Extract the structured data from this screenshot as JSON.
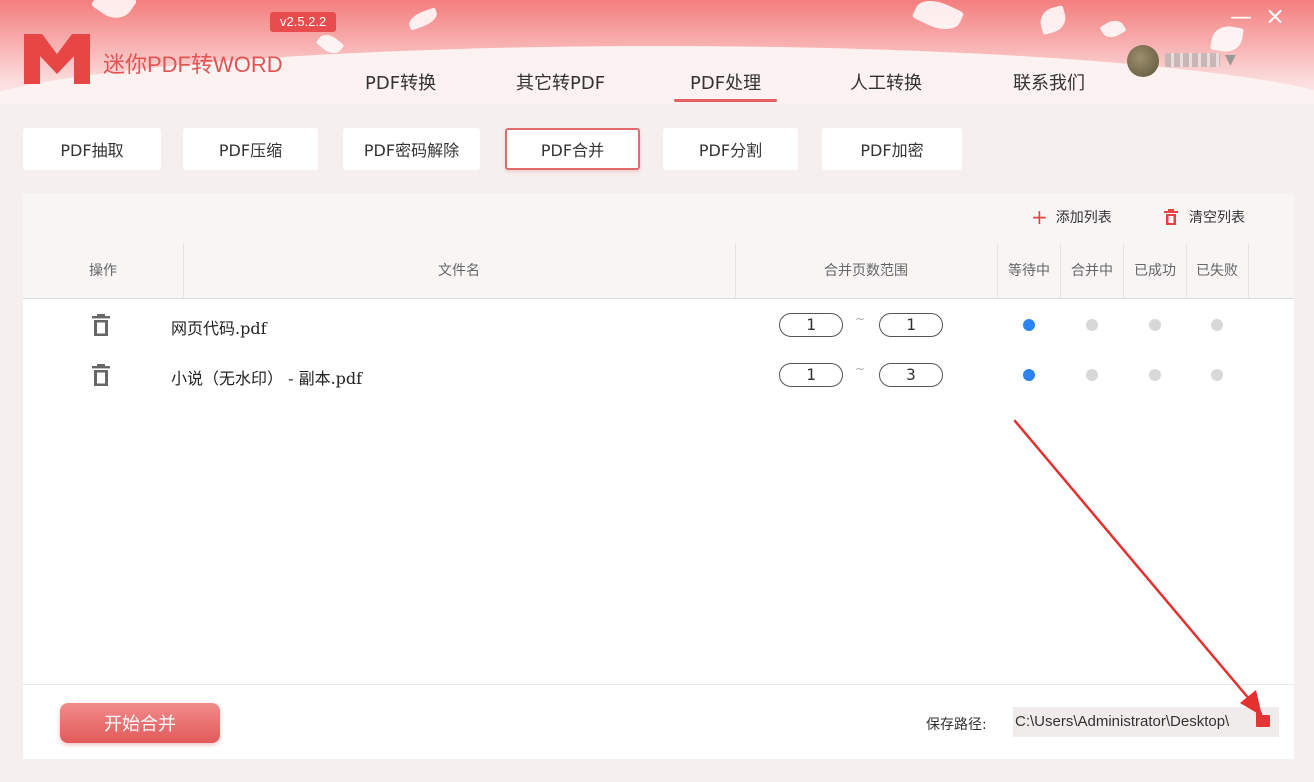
{
  "app": {
    "title": "迷你PDF转WORD",
    "version": "v2.5.2.2",
    "window_min": "—",
    "window_close": "×",
    "user_caret": "▼"
  },
  "nav": [
    {
      "label": "PDF转换"
    },
    {
      "label": "其它转PDF"
    },
    {
      "label": "PDF处理",
      "active": true
    },
    {
      "label": "人工转换"
    },
    {
      "label": "联系我们"
    }
  ],
  "subtabs": [
    {
      "label": "PDF抽取"
    },
    {
      "label": "PDF压缩"
    },
    {
      "label": "PDF密码解除"
    },
    {
      "label": "PDF合并",
      "active": true
    },
    {
      "label": "PDF分割"
    },
    {
      "label": "PDF加密"
    }
  ],
  "toolbar": {
    "add_label": "添加列表",
    "clear_label": "清空列表"
  },
  "table": {
    "columns": [
      "操作",
      "文件名",
      "合并页数范围",
      "等待中",
      "合并中",
      "已成功",
      "已失败"
    ],
    "tilde": "~",
    "rows": [
      {
        "filename": "网页代码.pdf",
        "from": "1",
        "to": "1",
        "status": "等待中"
      },
      {
        "filename": "小说（无水印） - 副本.pdf",
        "from": "1",
        "to": "3",
        "status": "等待中"
      }
    ]
  },
  "footer": {
    "start_label": "开始合并",
    "save_label": "保存路径:",
    "save_path": "C:\\Users\\Administrator\\Desktop\\"
  },
  "colors": {
    "accent": "#e25a5a",
    "status_active": "#2c84f2",
    "status_idle": "#d8d8d8",
    "arrow": "#e53030"
  }
}
